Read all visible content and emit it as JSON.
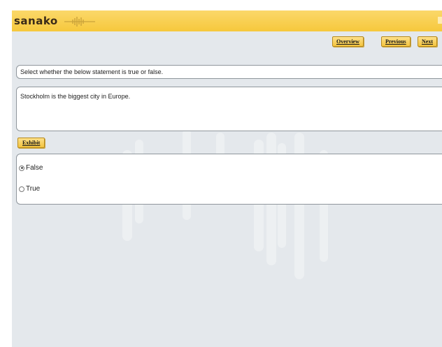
{
  "brand": {
    "logo_text": "sanako",
    "accent_color": "#f6c83c",
    "background_color": "#e4e8ec"
  },
  "nav": {
    "overview_label": "Overview",
    "previous_label": "Previous",
    "next_label": "Next"
  },
  "instruction": "Select whether the below statement is true or false.",
  "question": "Stockholm is the biggest city in Europe.",
  "exhibit_label": "Exhibit",
  "answers": {
    "options": [
      {
        "label": "False",
        "selected": true
      },
      {
        "label": "True",
        "selected": false
      }
    ]
  }
}
